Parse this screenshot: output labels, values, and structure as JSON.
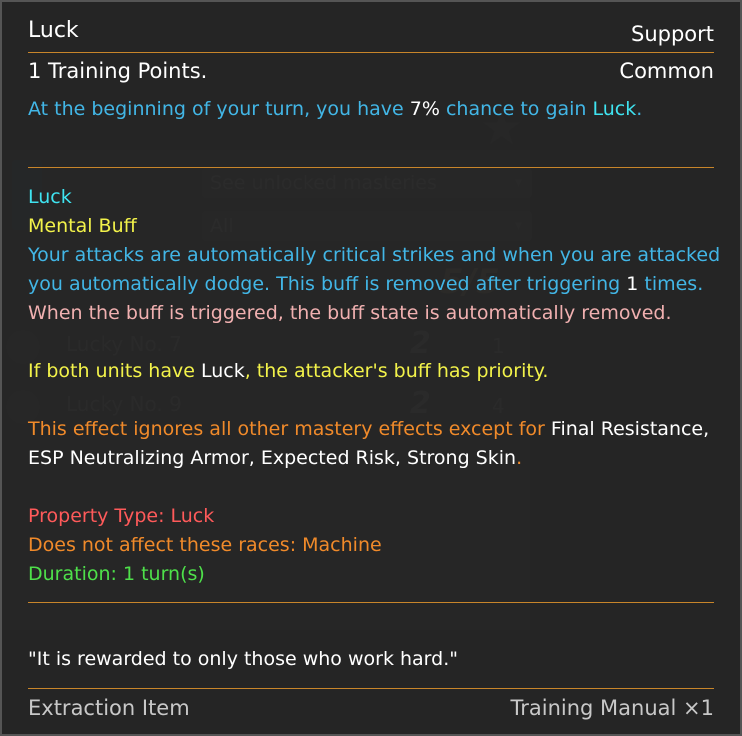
{
  "background": {
    "select1": "See unlocked masteries",
    "select2": "All",
    "rows": [
      {
        "name": "Lucky No. 7",
        "n1": "2",
        "n2": "1"
      },
      {
        "name": "Lucky No. 9",
        "n1": "2",
        "n2": "4"
      }
    ],
    "score": "5/5"
  },
  "tooltip": {
    "title": "Luck",
    "category": "Support",
    "cost": "1 Training Points.",
    "rarity": "Common",
    "desc_a": "At the beginning of your turn, you have ",
    "desc_b": "7%",
    "desc_c": " chance to gain ",
    "desc_d": "Luck",
    "desc_e": ".",
    "buff_name": "Luck",
    "buff_type": "Mental Buff",
    "effect_line1": "Your attacks are automatically critical strikes and when you are attacked",
    "effect_line2a": "you automatically dodge. This buff is removed after triggering ",
    "effect_line2b": "1",
    "effect_line2c": " times.",
    "trigger_line": "When the buff is triggered, the buff state is automatically removed.",
    "priority_a": "If both units have ",
    "priority_b": "Luck",
    "priority_c": ", the attacker's buff has priority.",
    "ignore_a": "This effect ignores all other mastery effects except for ",
    "ignore_b": "Final Resistance,",
    "ignore_line2a": "ESP Neutralizing Armor, Expected Risk, Strong Skin",
    "ignore_line2b": ".",
    "property_type": "Property Type: Luck",
    "races": "Does not affect these races: Machine",
    "duration": "Duration: 1 turn(s)",
    "quote": "\"It is rewarded to only those who work hard.\"",
    "footer_left": "Extraction Item",
    "footer_right": "Training Manual ×1"
  },
  "colors": {
    "accent_line": "#c8852a",
    "description_blue": "#42b6e6",
    "buff_name_cyan": "#3fe3f0",
    "buff_type_yellow": "#f2f24a",
    "trigger_pink": "#f0b0b0",
    "ignore_orange": "#f08a2a",
    "property_red": "#ff5a5a",
    "duration_green": "#4ee04a"
  }
}
